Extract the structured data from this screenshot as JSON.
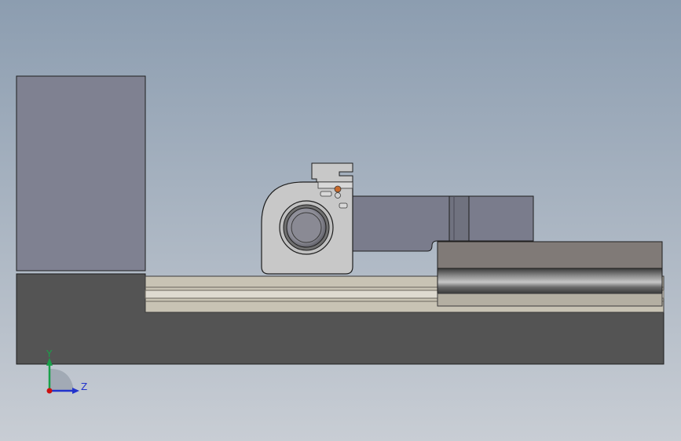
{
  "viewport": {
    "background_top": "#8c9db0",
    "background_bottom": "#c8cdd4"
  },
  "colors": {
    "base_dark": "#545454",
    "block_left": "#7f8191",
    "rail_beige": "#c8c3b4",
    "rail_light": "#dedad0",
    "housing_light": "#c8c8c8",
    "bearing_ring": "#707070",
    "arm_blue": "#7a7c8c",
    "carriage_top": "#807a77",
    "roller_dark": "#4b4b4b",
    "accent_orange": "#c86a2c",
    "axis_green": "#1aa04a",
    "axis_blue": "#2233cc",
    "axis_red": "#cc1010"
  },
  "triad": {
    "y_label": "Y",
    "z_label": "Z"
  }
}
